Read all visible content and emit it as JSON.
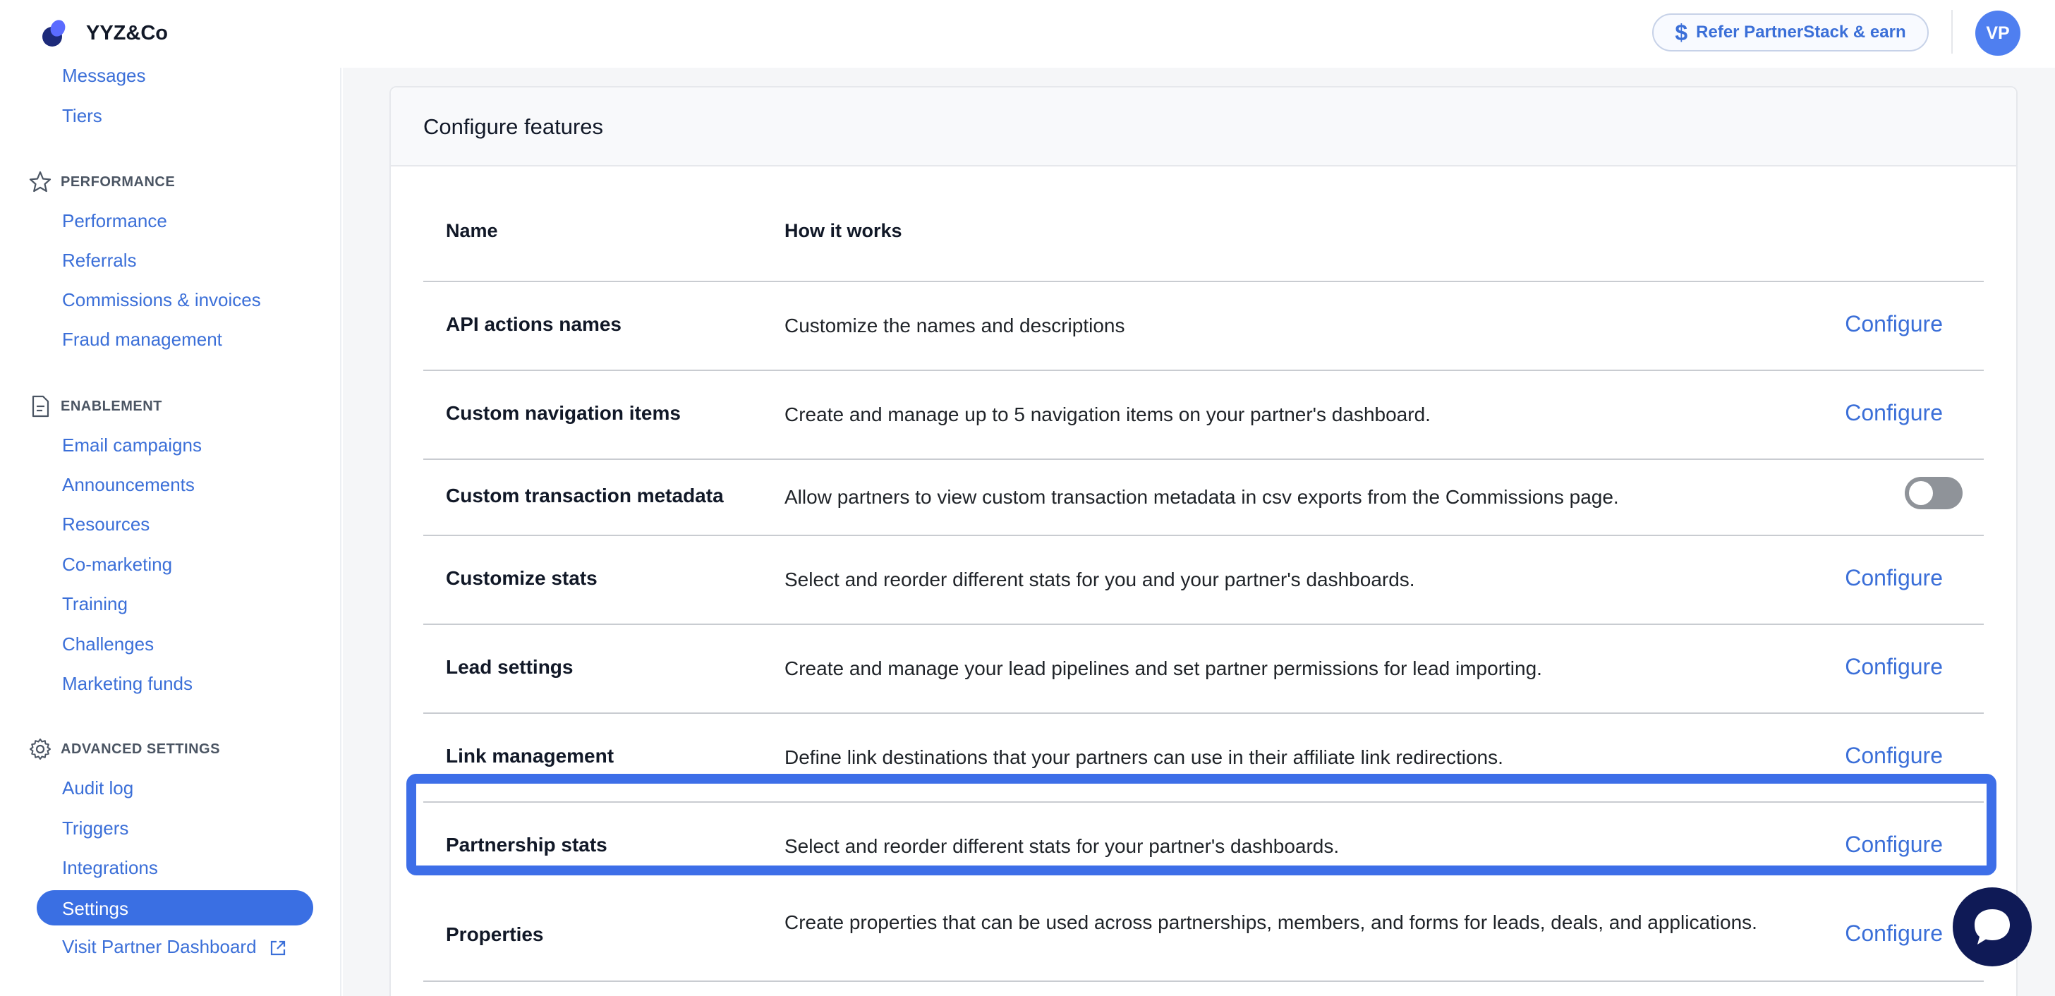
{
  "brand": {
    "name": "YYZ&Co"
  },
  "header": {
    "refer_label": "Refer PartnerStack & earn",
    "refer_icon": "dollar-icon",
    "avatar_initials": "VP"
  },
  "sidebar": {
    "top_items": [
      {
        "label": "Messages"
      },
      {
        "label": "Tiers"
      }
    ],
    "sections": [
      {
        "title": "PERFORMANCE",
        "icon": "star-icon",
        "items": [
          "Performance",
          "Referrals",
          "Commissions & invoices",
          "Fraud management"
        ]
      },
      {
        "title": "ENABLEMENT",
        "icon": "document-icon",
        "items": [
          "Email campaigns",
          "Announcements",
          "Resources",
          "Co-marketing",
          "Training",
          "Challenges",
          "Marketing funds"
        ]
      },
      {
        "title": "ADVANCED SETTINGS",
        "icon": "gear-icon",
        "items": [
          "Audit log",
          "Triggers",
          "Integrations",
          "Settings",
          "Visit Partner Dashboard"
        ]
      }
    ],
    "active_item": "Settings"
  },
  "card": {
    "title": "Configure features",
    "columns": {
      "name": "Name",
      "how": "How it works"
    },
    "rows": [
      {
        "name": "API actions names",
        "description": "Customize the names and descriptions",
        "action": "Configure"
      },
      {
        "name": "Custom navigation items",
        "description": "Create and manage up to 5 navigation items on your partner's dashboard.",
        "action": "Configure"
      },
      {
        "name": "Custom transaction metadata",
        "description": "Allow partners to view custom transaction metadata in csv exports from the Commissions page.",
        "action": "toggle",
        "toggle_on": false
      },
      {
        "name": "Customize stats",
        "description": "Select and reorder different stats for you and your partner's dashboards.",
        "action": "Configure"
      },
      {
        "name": "Lead settings",
        "description": "Create and manage your lead pipelines and set partner permissions for lead importing.",
        "action": "Configure"
      },
      {
        "name": "Link management",
        "description": "Define link destinations that your partners can use in their affiliate link redirections.",
        "action": "Configure"
      },
      {
        "name": "Partnership stats",
        "description": "Select and reorder different stats for your partner's dashboards.",
        "action": "Configure",
        "highlighted": true
      },
      {
        "name": "Properties",
        "description": "Create properties that can be used across partnerships, members, and forms for leads, deals, and applications.",
        "action": "Configure"
      }
    ]
  },
  "colors": {
    "accent": "#3b6fd8",
    "active_nav": "#3a6fe3",
    "highlight": "#3d6ee8",
    "chat": "#0f1a56"
  }
}
